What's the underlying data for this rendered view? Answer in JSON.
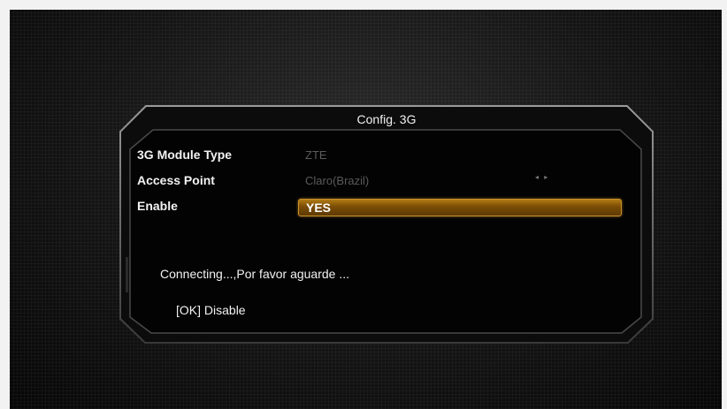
{
  "dialog": {
    "title": "Config. 3G",
    "rows": [
      {
        "label": "3G Module Type",
        "value": "ZTE"
      },
      {
        "label": "Access Point",
        "value": "Claro(Brazil)",
        "arrows": "◂ ▸"
      },
      {
        "label": "Enable",
        "value": "YES"
      }
    ],
    "status_message": "Connecting...,Por favor aguarde ...",
    "ok_hint": "[OK] Disable"
  },
  "colors": {
    "highlight": "#8a5a0a",
    "highlight_border": "#c9922a",
    "dim_value": "#5a5a5a"
  }
}
